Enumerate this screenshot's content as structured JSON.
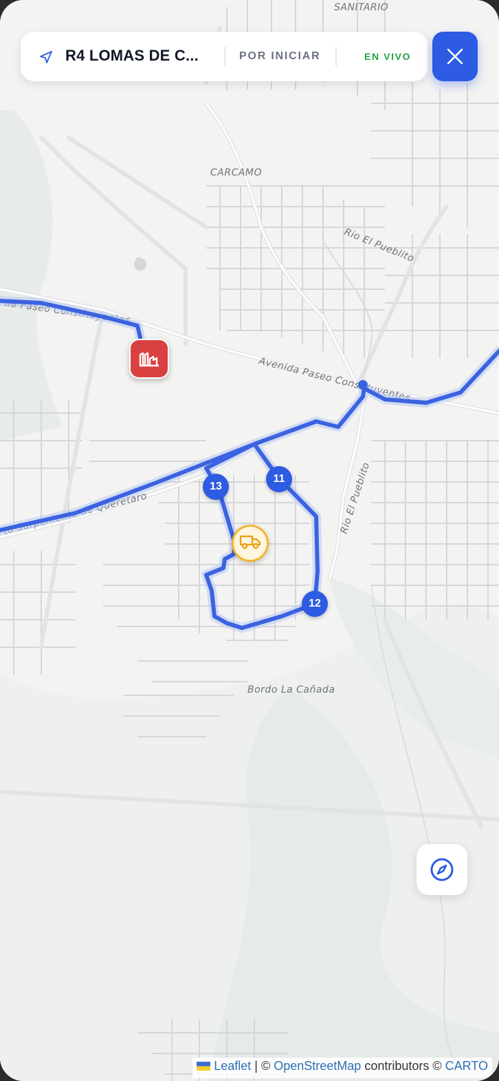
{
  "header": {
    "route_title": "R4 LOMAS DE C...",
    "status": "POR INICIAR",
    "live": "EN VIVO"
  },
  "map": {
    "labels": {
      "sanitario": "SANITARIO",
      "carcamo": "CARCAMO",
      "rio_el_pueblito_top": "Rio El Pueblito",
      "paseo_const_west": "da Paseo Constituyentes",
      "avenida_paseo": "Avenida Paseo Constituyentes",
      "surponiente": "to Surponiente de Queretaro",
      "rio_el_pueblito": "Rio El Pueblito",
      "bordo": "Bordo La Cañada"
    },
    "stops": [
      {
        "label": "13"
      },
      {
        "label": "11"
      },
      {
        "label": "12"
      }
    ],
    "route_color": "#3b63e0"
  },
  "attribution": {
    "leaflet": "Leaflet",
    "sep": " | © ",
    "osm": "OpenStreetMap",
    "contrib": " contributors © ",
    "carto": "CARTO"
  }
}
